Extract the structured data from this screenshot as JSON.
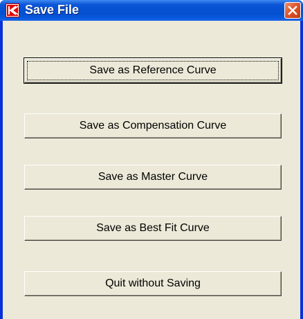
{
  "window": {
    "title": "Save File"
  },
  "buttons": [
    {
      "label": "Save as Reference Curve"
    },
    {
      "label": "Save as Compensation Curve"
    },
    {
      "label": "Save as Master Curve"
    },
    {
      "label": "Save as Best Fit Curve"
    },
    {
      "label": "Quit without Saving"
    }
  ],
  "colors": {
    "titlebar": "#0650d2",
    "close_button": "#e0562e",
    "dialog_face": "#ece9d8",
    "app_icon": "#e00000"
  },
  "icons": {
    "app": "k-logo-icon",
    "close": "close-icon"
  }
}
